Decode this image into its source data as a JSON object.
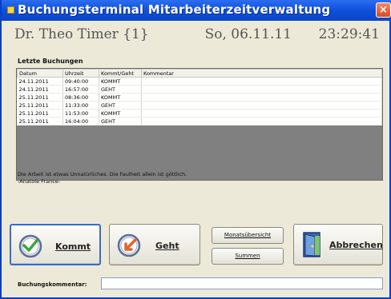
{
  "window": {
    "title": "Buchungsterminal Mitarbeiterzeitverwaltung",
    "close_glyph": "×"
  },
  "header": {
    "user": "Dr. Theo Timer {1}",
    "date": "So, 06.11.11",
    "time": "23:29:41"
  },
  "bookings": {
    "title": "Letzte Buchungen",
    "columns": [
      "Datum",
      "Uhrzeit",
      "Kommt/Geht",
      "Kommentar"
    ],
    "rows": [
      [
        "24.11.2011",
        "09:40:00",
        "KOMMT",
        ""
      ],
      [
        "24.11.2011",
        "16:57:00",
        "GEHT",
        ""
      ],
      [
        "25.11.2011",
        "08:36:00",
        "KOMMT",
        ""
      ],
      [
        "25.11.2011",
        "11:33:00",
        "GEHT",
        ""
      ],
      [
        "25.11.2011",
        "11:53:00",
        "KOMMT",
        ""
      ],
      [
        "25.11.2011",
        "16:04:00",
        "GEHT",
        ""
      ]
    ]
  },
  "quote": {
    "text": "Die Arbeit ist etwas Unnatürliches. Die Faulheit allein ist göttlich.",
    "author": "-Anatole France-"
  },
  "buttons": {
    "kommt": "Kommt",
    "geht": "Geht",
    "monatsuebersicht": "Monatsübersicht",
    "summen": "Summen",
    "abbrechen": "Abbrechen"
  },
  "icons": {
    "kommt": "clock-arrow-in-icon",
    "geht": "clock-arrow-out-icon",
    "abbrechen": "door-exit-icon"
  },
  "comment": {
    "label": "Buchungskommentar:",
    "value": ""
  },
  "colors": {
    "titlebar": "#0e4fdc",
    "table_background": "#808080",
    "accent_green": "#3aa63a",
    "accent_orange": "#e2662a"
  }
}
